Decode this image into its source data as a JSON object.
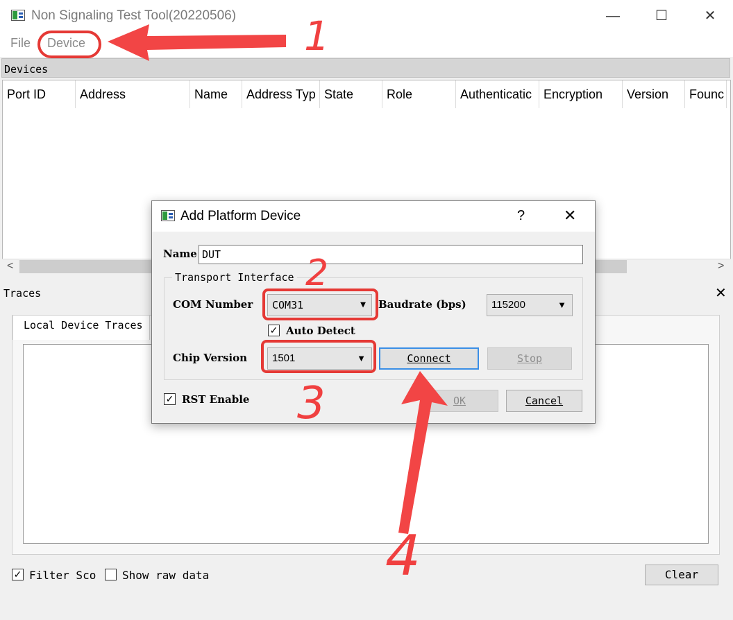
{
  "window": {
    "title": "Non Signaling Test Tool(20220506)",
    "minimize_glyph": "—",
    "maximize_glyph": "☐",
    "close_glyph": "✕"
  },
  "menubar": {
    "file": "File",
    "device": "Device"
  },
  "devices": {
    "dock_title": "Devices",
    "columns": [
      "Port ID",
      "Address",
      "Name",
      "Address Typ",
      "State",
      "Role",
      "Authenticatic",
      "Encryption",
      "Version",
      "Founc"
    ],
    "scroll_left": "<",
    "scroll_right": ">"
  },
  "traces": {
    "dock_title": "Traces",
    "close_glyph": "✕",
    "tab_label": "Local Device Traces",
    "filter_sco_label": "Filter Sco",
    "filter_sco_checked": true,
    "show_raw_label": "Show raw data",
    "show_raw_checked": false,
    "clear_label": "Clear"
  },
  "dialog": {
    "title": "Add Platform Device",
    "help_glyph": "?",
    "close_glyph": "✕",
    "name_label": "Name",
    "name_value": "DUT",
    "transport_label": "Transport Interface",
    "com_label": "COM Number",
    "com_value": "COM31",
    "baud_label": "Baudrate (bps)",
    "baud_value": "115200",
    "auto_detect_label": "Auto Detect",
    "auto_detect_checked": true,
    "chip_label": "Chip Version",
    "chip_value": "1501",
    "connect_label": "Connect",
    "stop_label": "Stop",
    "rst_label": "RST Enable",
    "rst_checked": true,
    "ok_label": "OK",
    "cancel_label": "Cancel"
  },
  "annotations": {
    "color": "#e53935",
    "step1": "1",
    "step2": "2",
    "step3": "3",
    "step4": "4"
  },
  "icons": {
    "check": "✓",
    "dropdown": "▼"
  }
}
